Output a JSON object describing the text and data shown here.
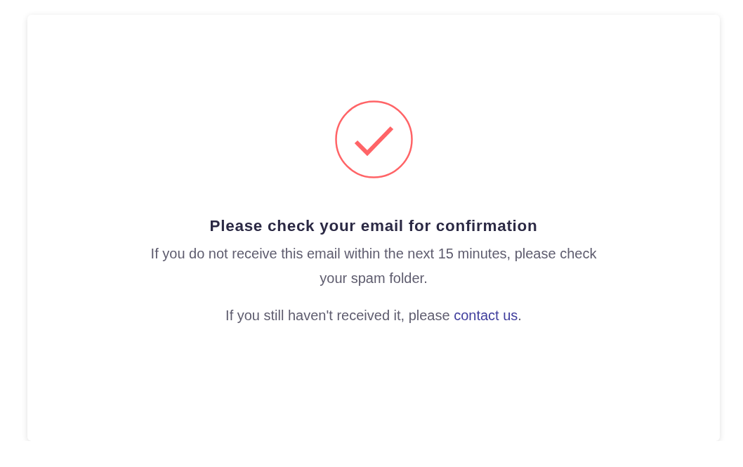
{
  "confirmation": {
    "title": "Please check your email for confirmation",
    "message": "If you do not receive this email within the next 15 minutes, please check your spam folder.",
    "followup": {
      "before": "If you still haven't received it, please ",
      "link": "contact us",
      "after": "."
    }
  }
}
